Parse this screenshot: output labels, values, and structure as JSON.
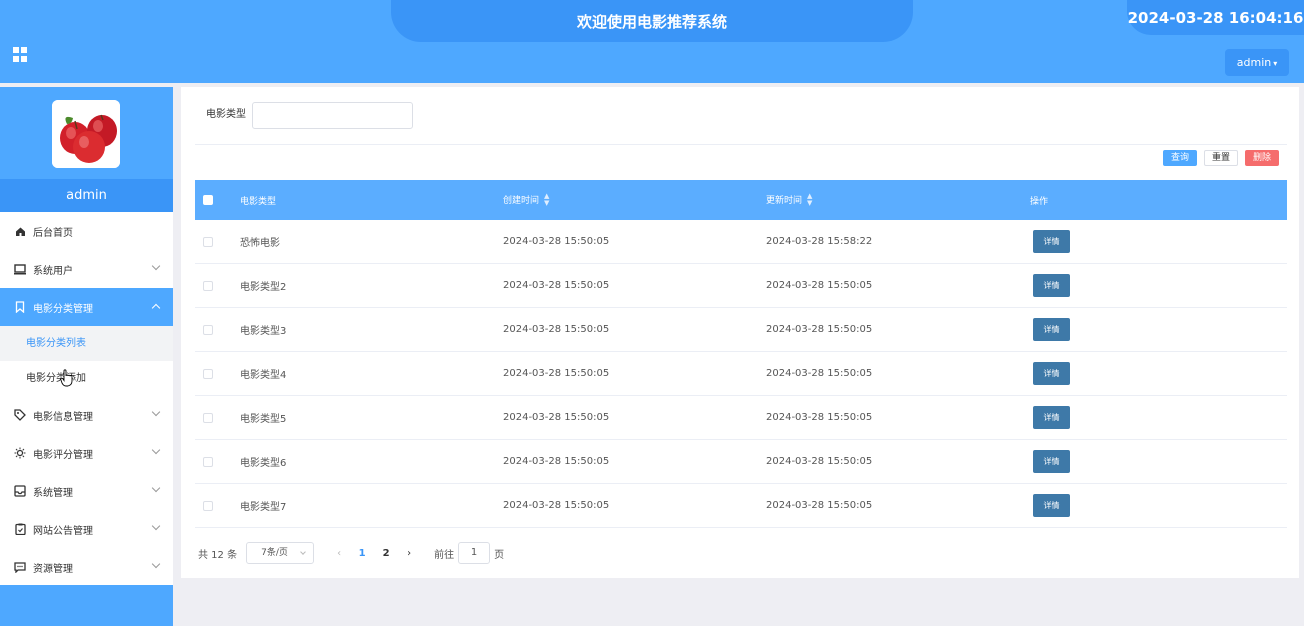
{
  "header": {
    "title": "欢迎使用电影推荐系统",
    "datetime": "2024-03-28 16:04:16",
    "user_button": "admin",
    "accent": "#4ea8ff"
  },
  "sidebar": {
    "username": "admin",
    "menu": [
      {
        "label": "后台首页",
        "icon": "home-icon"
      },
      {
        "label": "系统用户",
        "icon": "monitor-icon"
      },
      {
        "label": "电影分类管理",
        "icon": "bookmark-icon",
        "submenu": [
          "电影分类列表",
          "电影分类添加"
        ]
      },
      {
        "label": "电影信息管理",
        "icon": "tag-icon"
      },
      {
        "label": "电影评分管理",
        "icon": "sun-icon"
      },
      {
        "label": "系统管理",
        "icon": "inbox-icon"
      },
      {
        "label": "网站公告管理",
        "icon": "clipboard-icon"
      },
      {
        "label": "资源管理",
        "icon": "message-icon"
      }
    ]
  },
  "search": {
    "label": "电影类型",
    "value": ""
  },
  "actions": {
    "query": "查询",
    "reset": "重置",
    "delete": "删除"
  },
  "table": {
    "headers": [
      "电影类型",
      "创建时间",
      "更新时间",
      "操作"
    ],
    "detail_label": "详情",
    "rows": [
      {
        "type": "恐怖电影",
        "created": "2024-03-28 15:50:05",
        "updated": "2024-03-28 15:58:22"
      },
      {
        "type": "电影类型2",
        "created": "2024-03-28 15:50:05",
        "updated": "2024-03-28 15:50:05"
      },
      {
        "type": "电影类型3",
        "created": "2024-03-28 15:50:05",
        "updated": "2024-03-28 15:50:05"
      },
      {
        "type": "电影类型4",
        "created": "2024-03-28 15:50:05",
        "updated": "2024-03-28 15:50:05"
      },
      {
        "type": "电影类型5",
        "created": "2024-03-28 15:50:05",
        "updated": "2024-03-28 15:50:05"
      },
      {
        "type": "电影类型6",
        "created": "2024-03-28 15:50:05",
        "updated": "2024-03-28 15:50:05"
      },
      {
        "type": "电影类型7",
        "created": "2024-03-28 15:50:05",
        "updated": "2024-03-28 15:50:05"
      }
    ]
  },
  "pagination": {
    "total": "共 12 条",
    "page_size": "7条/页",
    "pages": [
      "1",
      "2"
    ],
    "current_page": "1",
    "goto_label": "前往",
    "goto_value": "1",
    "page_suffix": "页"
  }
}
